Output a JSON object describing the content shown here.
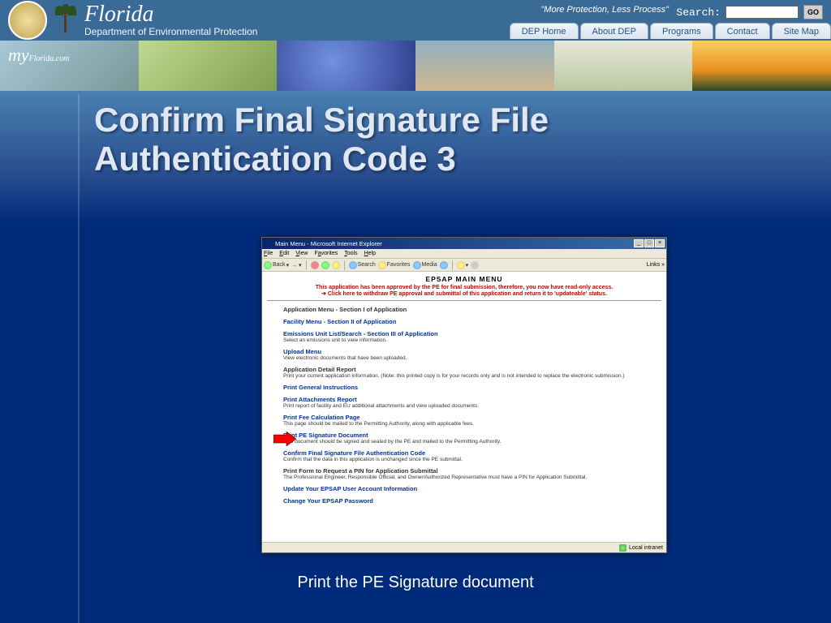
{
  "header": {
    "state": "Florida",
    "dept": "Department of Environmental Protection",
    "tagline": "\"More Protection, Less Process\"",
    "search_label": "Search:",
    "go": "GO",
    "myfl": "my",
    "myfl2": "Florida.com",
    "nav": [
      "DEP Home",
      "About DEP",
      "Programs",
      "Contact",
      "Site Map"
    ]
  },
  "slide": {
    "title_l1": "Confirm Final Signature File",
    "title_l2": "Authentication Code 3",
    "caption": "Print the PE Signature document"
  },
  "browser": {
    "title": "Main Menu - Microsoft Internet Explorer",
    "menus": {
      "file": "File",
      "edit": "Edit",
      "view": "View",
      "favorites": "Favorites",
      "tools": "Tools",
      "help": "Help"
    },
    "toolbar": {
      "back": "Back",
      "search": "Search",
      "favorites": "Favorites",
      "media": "Media",
      "links": "Links"
    },
    "status": "Local intranet",
    "page_title": "EPSAP MAIN MENU",
    "notice1": "This application has been approved by the PE for final submission, therefore, you now have read-only access.",
    "notice2": "Click here to withdraw PE approval and submittal of this application and return it to 'updateable' status.",
    "sections": {
      "app_menu": "Application Menu - Section I of Application",
      "facility": "Facility Menu - Section II of Application",
      "emissions": "Emissions Unit List/Search - Section III of Application",
      "emissions_d": "Select an emissions unit to view information.",
      "upload": "Upload Menu",
      "upload_d": "View electronic documents that have been uploaded.",
      "detail": "Application Detail Report",
      "detail_d": "Print your current application information. (Note: this printed copy is for your records only and is not intended to replace the electronic submission.)",
      "instr": "Print General Instructions",
      "attach": "Print Attachments Report",
      "attach_d": "Print report of facility and EU additional attachments and view uploaded documents.",
      "fee": "Print Fee Calculation Page",
      "fee_d": "This page should be mailed to the Permitting Authority, along with applicable fees.",
      "sig": "Print PE Signature Document",
      "sig_d": "This document should be signed and sealed by the PE and mailed to the Permitting Authority.",
      "confirm": "Confirm Final Signature File Authentication Code",
      "confirm_d": "Confirm that the data in this application is unchanged since the PE submittal.",
      "pin": "Print Form to Request a PIN for Application Submittal",
      "pin_d": "The Professional Engineer, Responsible Official, and Owner/Authorized Representative must have a PIN for Application Submittal.",
      "update": "Update Your EPSAP User Account Information",
      "pwd": "Change Your EPSAP Password"
    }
  }
}
